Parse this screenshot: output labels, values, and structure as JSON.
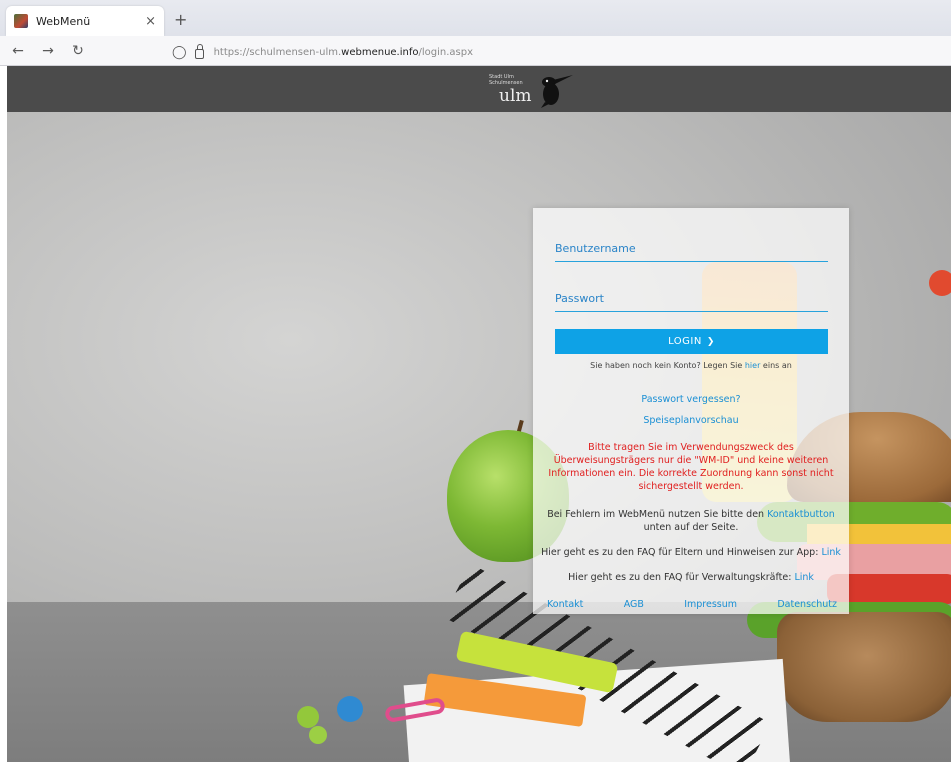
{
  "browser": {
    "tab_title": "WebMenü",
    "tab_close": "×",
    "new_tab": "+",
    "url_prefix": "https://schulmensen-ulm.",
    "url_domain": "webmenue.info",
    "url_path": "/login.aspx"
  },
  "header": {
    "logo_small_line1": "Stadt Ulm",
    "logo_small_line2": "Schulmensen",
    "logo_text": "ulm"
  },
  "login": {
    "username_placeholder": "Benutzername",
    "password_placeholder": "Passwort",
    "login_button": "LOGIN",
    "register_prefix": "Sie haben noch kein Konto? Legen Sie ",
    "register_link": "hier",
    "register_suffix": " eins an",
    "forgot_password": "Passwort vergessen?",
    "menu_preview": "Speiseplanvorschau",
    "notice": "Bitte tragen Sie im Verwendungszweck des Überweisungsträgers nur die \"WM-ID\" und keine weiteren Informationen ein. Die korrekte Zuordnung kann sonst nicht sichergestellt werden.",
    "help_prefix": "Bei Fehlern im WebMenü nutzen Sie bitte den ",
    "help_link": "Kontaktbutton",
    "help_suffix": " unten auf der Seite.",
    "faq_parents_text": "Hier geht es zu den FAQ für Eltern und Hinweisen zur App: ",
    "faq_parents_link": "Link",
    "faq_admin_text": "Hier geht es zu den FAQ für Verwaltungskräfte: ",
    "faq_admin_link": "Link"
  },
  "footer": {
    "links": [
      "Kontakt",
      "AGB",
      "Impressum",
      "Datenschutz"
    ]
  },
  "colors": {
    "accent": "#0ea2e6",
    "link": "#1a8fd4",
    "notice": "#e02020",
    "header_bg": "#4b4b4b"
  }
}
